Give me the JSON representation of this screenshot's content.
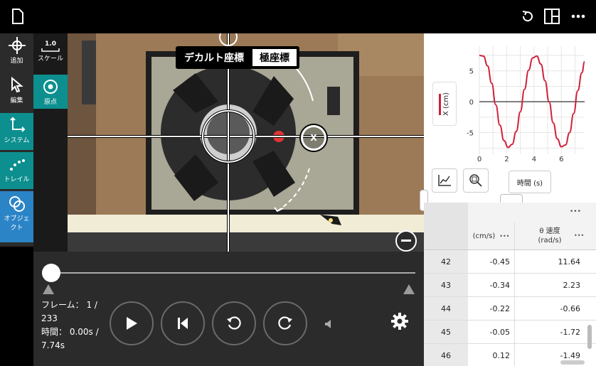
{
  "toolbar": {
    "add_label": "追加",
    "edit_label": "編集",
    "system_label": "システム",
    "trail_label": "トレイル",
    "object_label": "オブジェクト"
  },
  "subtools": {
    "scale_value": "1.0",
    "scale_label": "スケール",
    "origin_label": "原点"
  },
  "video": {
    "tab_cartesian": "デカルト座標",
    "tab_polar": "極座標",
    "point_label": "X"
  },
  "playback": {
    "frame_text": "フレーム： 1 / 233",
    "time_text": "時間： 0.00s / 7.74s",
    "slider_position": 0
  },
  "graph": {
    "y_axis_label": "X (cm)",
    "x_axis_button": "時間 (s)",
    "line_color": "#d0203a"
  },
  "chart_data": {
    "type": "line",
    "title": "",
    "xlabel": "時間 (s)",
    "ylabel": "X (cm)",
    "xlim": [
      0,
      7.7
    ],
    "ylim": [
      -8.5,
      9
    ],
    "xticks": [
      "0",
      "2",
      "4",
      "6"
    ],
    "yticks": [
      "5",
      "0",
      "-5"
    ],
    "series": [
      {
        "x": [
          0.0,
          0.3,
          0.6,
          0.9,
          1.2,
          1.5,
          1.8,
          2.1,
          2.4,
          2.7,
          3.0,
          3.3,
          3.6,
          3.9,
          4.2,
          4.5,
          4.8,
          5.1,
          5.4,
          5.7,
          6.0,
          6.3,
          6.6,
          6.9,
          7.2,
          7.5,
          7.7
        ],
        "y": [
          7.5,
          7.4,
          5.8,
          3.0,
          -0.5,
          -3.8,
          -6.3,
          -7.4,
          -6.9,
          -4.8,
          -1.6,
          2.0,
          5.1,
          7.1,
          7.4,
          6.1,
          3.4,
          0.0,
          -3.4,
          -6.0,
          -7.3,
          -7.0,
          -5.0,
          -1.9,
          1.8,
          4.7,
          6.5
        ]
      }
    ]
  },
  "table": {
    "col1_header": "(cm/s)",
    "col2_header_line1": "θ 速度",
    "col2_header_line2": "(rad/s)",
    "menu_dots": "•••",
    "rows": [
      {
        "frame": "42",
        "v": "-0.45",
        "w": "11.64"
      },
      {
        "frame": "43",
        "v": "-0.34",
        "w": "2.23"
      },
      {
        "frame": "44",
        "v": "-0.22",
        "w": "-0.66"
      },
      {
        "frame": "45",
        "v": "-0.05",
        "w": "-1.72"
      },
      {
        "frame": "46",
        "v": "0.12",
        "w": "-1.49"
      }
    ]
  }
}
